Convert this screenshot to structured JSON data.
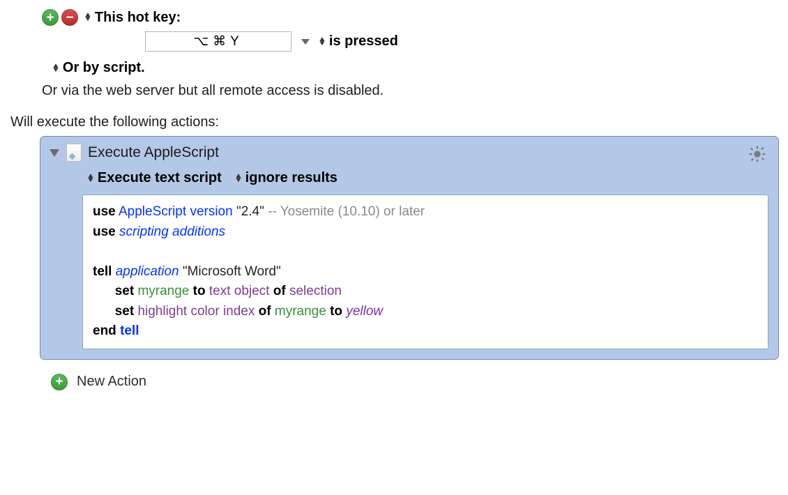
{
  "trigger": {
    "hotkey_label": "This hot key:",
    "hotkey_value": "⌥⌘Y",
    "state_label": "is pressed",
    "or_script_label": "Or by script.",
    "web_line": "Or via the web server but all remote access is disabled."
  },
  "will_execute_label": "Will execute the following actions:",
  "action": {
    "title": "Execute AppleScript",
    "option1": "Execute text script",
    "option2": "ignore results",
    "code": {
      "l1_use": "use",
      "l1_as": "AppleScript",
      "l1_ver": "version",
      "l1_str": "\"2.4\"",
      "l1_comment": "-- Yosemite (10.10) or later",
      "l2_use": "use",
      "l2_sa": "scripting additions",
      "l4_tell": "tell",
      "l4_app": "application",
      "l4_str": "\"Microsoft Word\"",
      "l5_set": "set",
      "l5_var": "myrange",
      "l5_to": "to",
      "l5_to2": "text object",
      "l5_of": "of",
      "l5_sel": "selection",
      "l6_set": "set",
      "l6_hci": "highlight color index",
      "l6_of": "of",
      "l6_var": "myrange",
      "l6_to": "to",
      "l6_yel": "yellow",
      "l7_end": "end",
      "l7_tell": "tell"
    }
  },
  "new_action_label": "New Action"
}
